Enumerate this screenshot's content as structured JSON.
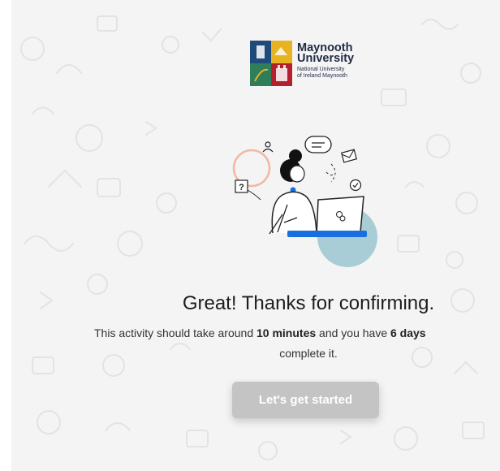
{
  "logo": {
    "name_line1": "Maynooth",
    "name_line2": "University",
    "sub_line1": "National University",
    "sub_line2": "of Ireland Maynooth",
    "colors": {
      "navy": "#1f4b7a",
      "gold": "#e8b323",
      "red": "#b5202e",
      "green": "#2e7d5b"
    }
  },
  "illustration": {
    "icon": "woman-at-laptop-illustration"
  },
  "message": {
    "headline": "Great! Thanks for confirming.",
    "desc_part1": "This activity should take around ",
    "desc_duration": "10 minutes",
    "desc_part2": " and you have ",
    "desc_days": "6 days",
    "desc_part3": "complete it."
  },
  "cta": {
    "label": "Let's get started",
    "state": "disabled",
    "color": "#c4c4c4"
  },
  "theme": {
    "background": "#f4f4f4",
    "text": "#1d1d1d",
    "accent_blue": "#1a6fe0",
    "accent_teal": "#a8cdd6",
    "accent_peach": "#f1b9a4"
  }
}
